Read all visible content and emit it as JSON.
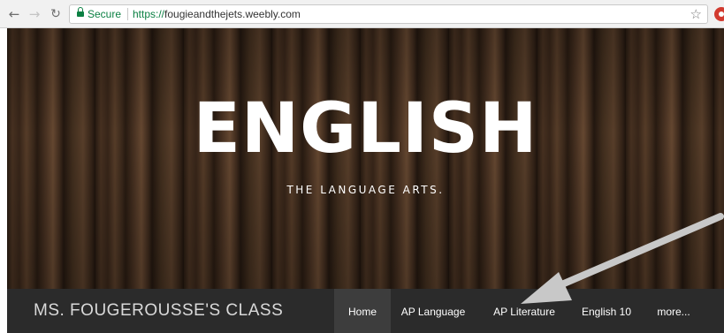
{
  "browser": {
    "back_icon": "arrow-left-icon",
    "forward_icon": "arrow-right-icon",
    "reload_icon": "reload-icon",
    "secure_label": "Secure",
    "url_scheme": "https://",
    "url_host": "fougieandthejets.weebly.com",
    "bookmark_icon": "star-icon",
    "extension_icon": "extension-icon",
    "secure_color": "#0b8043"
  },
  "hero": {
    "title": "ENGLISH",
    "subtitle": "THE LANGUAGE ARTS."
  },
  "site_nav": {
    "site_title": "MS. FOUGEROUSSE'S CLASS",
    "items": [
      {
        "label": "Home",
        "active": true
      },
      {
        "label": "AP Language"
      },
      {
        "label": "AP Literature"
      },
      {
        "label": "English 10"
      },
      {
        "label": "more..."
      }
    ],
    "bar_color": "#2b2b2b"
  },
  "annotation": {
    "arrow_icon": "annotation-arrow",
    "color": "#c8c8c8"
  }
}
